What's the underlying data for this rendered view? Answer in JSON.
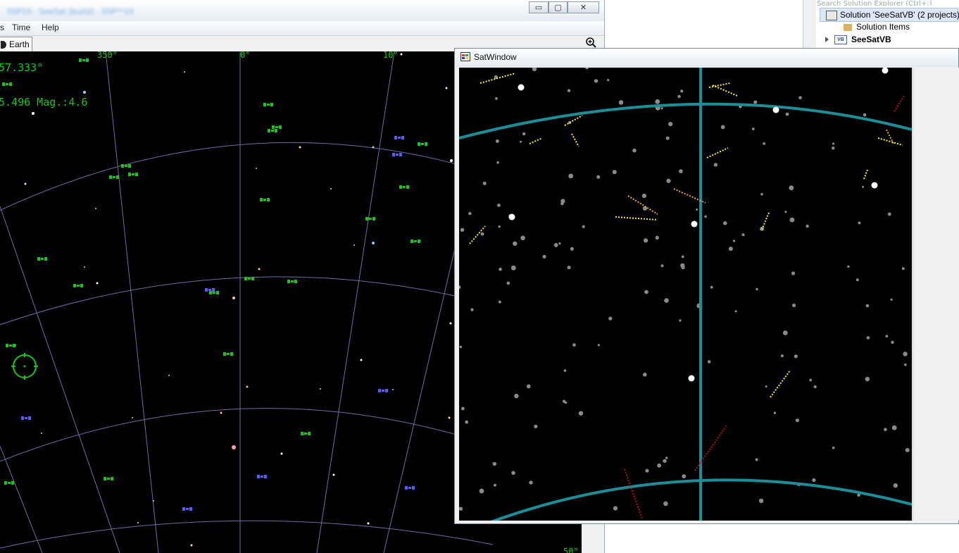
{
  "main_window": {
    "title": "SSP10 - SeeSat [build] - SSP**10",
    "buttons": {
      "minimize": "▭",
      "maximize": "▢",
      "close": "✕"
    },
    "menu": [
      "s",
      "Time",
      "Help"
    ],
    "tab": "Earth"
  },
  "sky_view": {
    "scale_labels": [
      "350°",
      "0°",
      "10°",
      "50°"
    ],
    "readout_angle": "57.333°",
    "readout_mag": "5.496 Mag.:4.6"
  },
  "sat_window": {
    "title": "SatWindow"
  },
  "solution_explorer": {
    "search_placeholder": "Search Solution Explorer (Ctrl+;)",
    "items": [
      {
        "label": "Solution 'SeeSatVB' (2 projects)",
        "icon": "solution-icon",
        "selected": true
      },
      {
        "label": "Solution Items",
        "icon": "folder-icon",
        "selected": false
      },
      {
        "label": "SeeSatVB",
        "icon": "vb-project-icon",
        "selected": false
      }
    ]
  },
  "colors": {
    "sky_bg": "#000000",
    "satellite_green": "#19c419",
    "satellite_blue": "#5a5aff",
    "grid_line": "#6c6ca8",
    "horizon_teal": "#1a8f99",
    "trail_yellow": "#ffea33",
    "trail_red": "#b01010"
  }
}
